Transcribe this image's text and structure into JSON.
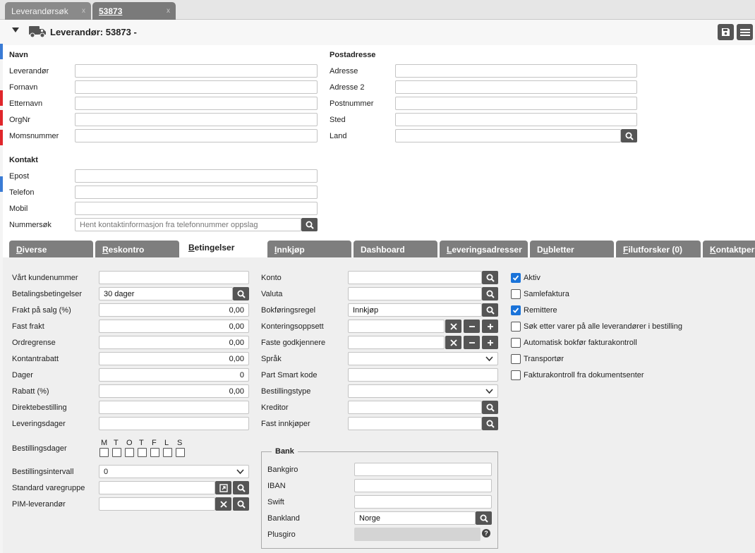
{
  "tabs": [
    {
      "label": "Leverandørsøk",
      "close": "x"
    },
    {
      "label": "53873",
      "close": "x"
    }
  ],
  "header": {
    "title": "Leverandør: 53873 -"
  },
  "navn": {
    "heading": "Navn",
    "fields": [
      {
        "label": "Leverandør",
        "value": ""
      },
      {
        "label": "Fornavn",
        "value": ""
      },
      {
        "label": "Etternavn",
        "value": ""
      },
      {
        "label": "OrgNr",
        "value": ""
      },
      {
        "label": "Momsnummer",
        "value": ""
      }
    ]
  },
  "postadresse": {
    "heading": "Postadresse",
    "fields": [
      {
        "label": "Adresse",
        "value": ""
      },
      {
        "label": "Adresse 2",
        "value": ""
      },
      {
        "label": "Postnummer",
        "value": ""
      },
      {
        "label": "Sted",
        "value": ""
      },
      {
        "label": "Land",
        "value": ""
      }
    ]
  },
  "kontakt": {
    "heading": "Kontakt",
    "fields": [
      {
        "label": "Epost",
        "value": ""
      },
      {
        "label": "Telefon",
        "value": ""
      },
      {
        "label": "Mobil",
        "value": ""
      },
      {
        "label": "Nummersøk",
        "placeholder": "Hent kontaktinformasjon fra telefonnummer oppslag"
      }
    ]
  },
  "subtabs": [
    {
      "pre": "",
      "u": "D",
      "post": "iverse"
    },
    {
      "pre": "",
      "u": "R",
      "post": "eskontro"
    },
    {
      "pre": "",
      "u": "B",
      "post": "etingelser"
    },
    {
      "pre": "",
      "u": "I",
      "post": "nnkjøp"
    },
    {
      "pre": "Dashboard",
      "u": "",
      "post": ""
    },
    {
      "pre": "",
      "u": "L",
      "post": "everingsadresser"
    },
    {
      "pre": "D",
      "u": "u",
      "post": "bletter"
    },
    {
      "pre": "",
      "u": "F",
      "post": "ilutforsker (0)"
    },
    {
      "pre": "",
      "u": "K",
      "post": "ontaktpersoner"
    }
  ],
  "col1": [
    {
      "label": "Vårt kundenummer",
      "value": ""
    },
    {
      "label": "Betalingsbetingelser",
      "value": "30 dager"
    },
    {
      "label": "Frakt på salg (%)",
      "value": "0,00"
    },
    {
      "label": "Fast frakt",
      "value": "0,00"
    },
    {
      "label": "Ordregrense",
      "value": "0,00"
    },
    {
      "label": "Kontantrabatt",
      "value": "0,00"
    },
    {
      "label": "Dager",
      "value": "0"
    },
    {
      "label": "Rabatt (%)",
      "value": "0,00"
    },
    {
      "label": "Direktebestilling",
      "value": ""
    },
    {
      "label": "Leveringsdager",
      "value": ""
    }
  ],
  "bestillingsdager": {
    "label": "Bestillingsdager",
    "days": [
      "M",
      "T",
      "O",
      "T",
      "F",
      "L",
      "S"
    ]
  },
  "col1b": [
    {
      "label": "Bestillingsintervall",
      "value": "0"
    },
    {
      "label": "Standard varegruppe",
      "value": ""
    },
    {
      "label": "PIM-leverandør",
      "value": ""
    }
  ],
  "col2": [
    {
      "label": "Konto",
      "value": ""
    },
    {
      "label": "Valuta",
      "value": ""
    },
    {
      "label": "Bokføringsregel",
      "value": "Innkjøp"
    },
    {
      "label": "Konteringsoppsett",
      "value": ""
    },
    {
      "label": "Faste godkjennere",
      "value": ""
    },
    {
      "label": "Språk",
      "value": ""
    },
    {
      "label": "Part Smart kode",
      "value": ""
    },
    {
      "label": "Bestillingstype",
      "value": ""
    },
    {
      "label": "Kreditor",
      "value": ""
    },
    {
      "label": "Fast innkjøper",
      "value": ""
    }
  ],
  "bank": {
    "legend": "Bank",
    "fields": [
      {
        "label": "Bankgiro",
        "value": ""
      },
      {
        "label": "IBAN",
        "value": ""
      },
      {
        "label": "Swift",
        "value": ""
      },
      {
        "label": "Bankland",
        "value": "Norge"
      },
      {
        "label": "Plusgiro",
        "value": ""
      }
    ]
  },
  "checkboxes": [
    {
      "label": "Aktiv",
      "checked": true
    },
    {
      "label": "Samlefaktura",
      "checked": false
    },
    {
      "label": "Remittere",
      "checked": true
    },
    {
      "label": "Søk etter varer på alle leverandører i bestilling",
      "checked": false
    },
    {
      "label": "Automatisk bokfør fakturakontroll",
      "checked": false
    },
    {
      "label": "Transportør",
      "checked": false
    },
    {
      "label": "Fakturakontroll fra dokumentsenter",
      "checked": false
    }
  ],
  "colors": {
    "accent": "#1a73d9",
    "tab": "#7e7e7e",
    "button": "#555555",
    "edge_red": "#e0262b",
    "edge_blue": "#3a7bd5"
  }
}
